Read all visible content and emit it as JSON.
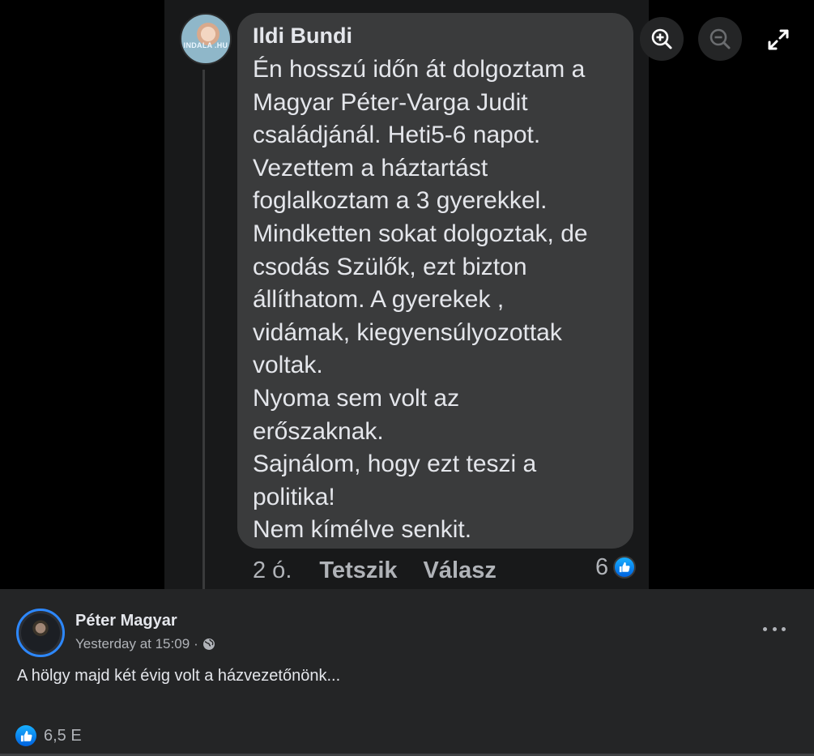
{
  "comment": {
    "author": "Ildi Bundi",
    "avatar_watermark": "INDALA .HU",
    "text": "Én hosszú időn át dolgoztam a\nMagyar Péter-Varga Judit\ncsaládjánál. Heti5-6 napot.\nVezettem a háztartást\nfoglalkoztam a 3 gyerekkel.\nMindketten sokat dolgoztak, de\ncsodás Szülők, ezt bizton\nállíthatom. A gyerekek ,\nvidámak, kiegyensúlyozottak\nvoltak.\nNyoma sem volt az\nerőszaknak.\nSajnálom, hogy ezt teszi a\npolitika!\nNem kímélve senkit.",
    "time": "2 ó.",
    "like_label": "Tetszik",
    "reply_label": "Válasz",
    "reaction_count": "6",
    "reaction_icon": "thumbs-up-icon"
  },
  "viewer_controls": {
    "zoom_in_icon": "zoom-in-icon",
    "zoom_out_icon": "zoom-out-icon",
    "expand_icon": "expand-icon"
  },
  "post": {
    "author": "Péter Magyar",
    "timestamp": "Yesterday at 15:09",
    "separator": "·",
    "privacy_icon": "globe-icon",
    "more_icon": "more-options-icon",
    "text": "A hölgy majd két évig volt a házvezetőnönk...",
    "reaction_count": "6,5 E",
    "reaction_icon": "thumbs-up-icon"
  },
  "colors": {
    "background": "#000000",
    "comment_panel": "#18191a",
    "bubble": "#3a3b3c",
    "post_card": "#242526",
    "primary_text": "#e4e6eb",
    "secondary_text": "#b0b3b8",
    "like_blue": "#1877f2",
    "avatar_ring": "#2d88ff"
  }
}
